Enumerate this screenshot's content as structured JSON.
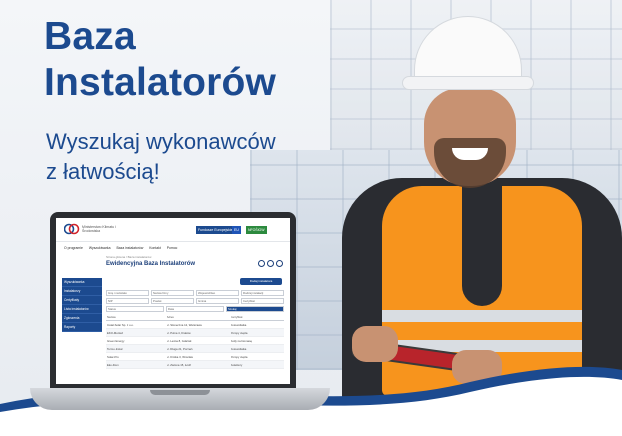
{
  "ad": {
    "headline_line1": "Baza",
    "headline_line2": "Instalatorów",
    "subline1": "Wyszukaj wykonawców",
    "subline2": "z łatwością!",
    "colors": {
      "brand": "#1c4a8f",
      "vest": "#f7941d",
      "tablet": "#b8242b"
    }
  },
  "screen": {
    "logo_text": "Ministerstwo Klimatu i Środowiska",
    "badge_fe": "Fundusze Europejskie",
    "badge_eu": "EU",
    "badge_nfos": "NFOŚiGW",
    "nav": [
      "O programie",
      "Wyszukiwarka",
      "Baza instalatorów",
      "Kontakt",
      "Pomoc"
    ],
    "breadcrumb": "Strona główna / Baza instalatorów",
    "title": "Ewidencyjna Baza Instalatorów",
    "add_button": "Dodaj instalatora",
    "sidebar": [
      "Wyszukiwarka",
      "Instalatorzy",
      "Certyfikaty",
      "Lista instalatorów",
      "Zgłoszenia",
      "Raporty"
    ],
    "filters": [
      [
        "Imię i nazwisko",
        "Nazwa firmy",
        "Województwo",
        "Rodzaj instalacji"
      ],
      [
        "NIP",
        "Powiat",
        "Gmina",
        "Certyfikat"
      ],
      [
        "Status",
        "Data",
        "Szukaj"
      ]
    ],
    "table_headers": [
      "Nazwa",
      "Adres",
      "Certyfikat"
    ],
    "table_rows": [
      [
        "Instal-Solar Sp. z o.o.",
        "ul. Słoneczna 12, Warszawa",
        "Fotowoltaika"
      ],
      [
        "EKO-Montaż",
        "ul. Polna 4, Kraków",
        "Pompy ciepła"
      ],
      [
        "Green Energy",
        "ul. Leśna 8, Gdańsk",
        "Kotły na biomasę"
      ],
      [
        "Termo-Instal",
        "ul. Długa 21, Poznań",
        "Fotowoltaika"
      ],
      [
        "Solar-Pro",
        "ul. Krótka 3, Wrocław",
        "Pompy ciepła"
      ],
      [
        "Eko-Dom",
        "ul. Zielona 15, Łódź",
        "Kolektory"
      ]
    ]
  }
}
